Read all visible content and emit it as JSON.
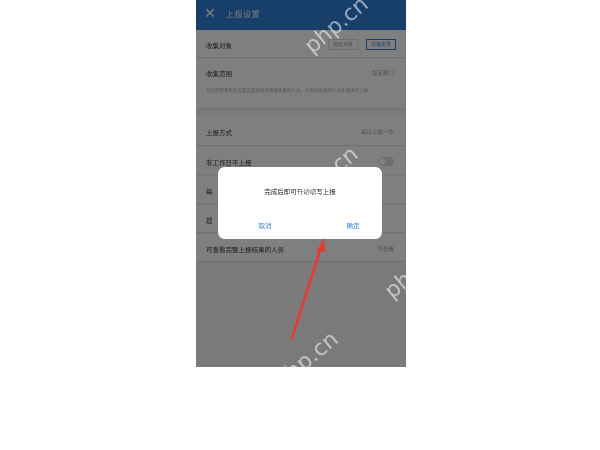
{
  "header": {
    "back_icon": "close-icon",
    "title": "上报设置"
  },
  "settings": {
    "collect_target": {
      "label": "收集对象",
      "options": [
        "指定对象",
        "非指定员"
      ],
      "selected_index": 1
    },
    "collect_scope": {
      "label": "收集范围",
      "value": "指定部门",
      "description": "开启后需要先在设置页面选择你需要收集的人员，只有你选择的人员才能填写上报"
    },
    "report_method": {
      "label": "上报方式",
      "value": "每日上报一次"
    },
    "skip_nonwork": {
      "label": "非工作日不上报",
      "enabled": false
    },
    "row5_label": "每",
    "row6_label": "提",
    "viewers": {
      "label": "可查看完整上报结果的人员",
      "value": "可查看"
    }
  },
  "dialog": {
    "message": "完成后即可开始填写上报",
    "cancel": "取消",
    "confirm": "确定"
  },
  "watermark": "php.cn",
  "colors": {
    "accent": "#2f7fd4",
    "arrow": "#e8392f"
  }
}
